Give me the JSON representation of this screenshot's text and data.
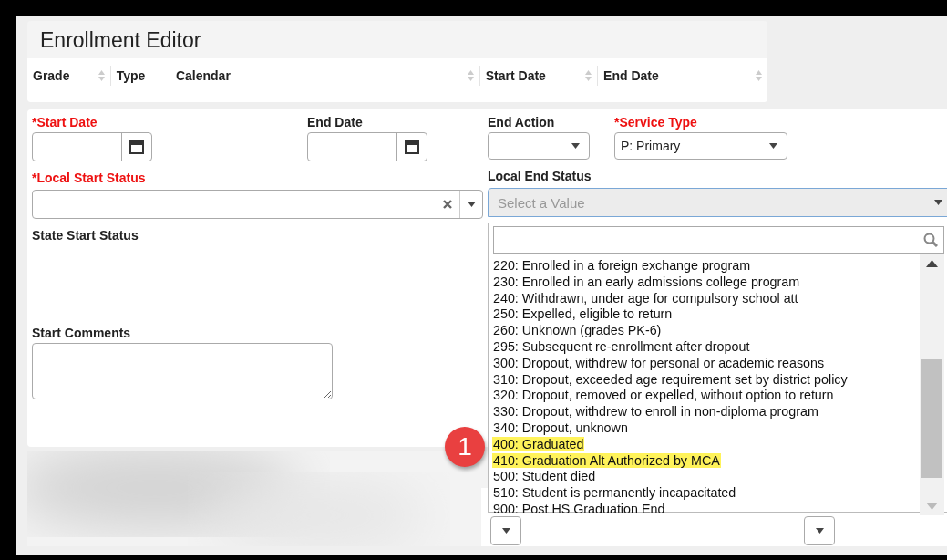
{
  "title": "Enrollment Editor",
  "columns": [
    {
      "label": "Grade",
      "sortable": true
    },
    {
      "label": "Type",
      "sortable": false
    },
    {
      "label": "Calendar",
      "sortable": true
    },
    {
      "label": "Start Date",
      "sortable": true
    },
    {
      "label": "End Date",
      "sortable": true
    }
  ],
  "start_date": {
    "label": "*Start Date",
    "required": true
  },
  "end_date": {
    "label": "End Date",
    "required": false
  },
  "end_action": {
    "label": "End Action",
    "required": false
  },
  "service_type": {
    "label": "*Service Type",
    "required": true,
    "value": "P: Primary"
  },
  "local_start_status": {
    "label": "*Local Start Status",
    "required": true
  },
  "local_end_status": {
    "label": "Local End Status",
    "required": false,
    "placeholder": "Select a Value",
    "expanded": true
  },
  "state_start_status": {
    "label": "State Start Status"
  },
  "start_comments": {
    "label": "Start Comments"
  },
  "options": [
    {
      "label": "220: Enrolled in a foreign exchange program",
      "highlighted": false
    },
    {
      "label": "230: Enrolled in an early admissions college program",
      "highlighted": false
    },
    {
      "label": "240: Withdrawn, under age for compulsory school att",
      "highlighted": false
    },
    {
      "label": "250: Expelled, eligible to return",
      "highlighted": false
    },
    {
      "label": "260: Unknown (grades PK-6)",
      "highlighted": false
    },
    {
      "label": "295: Subsequent re-enrollment after dropout",
      "highlighted": false
    },
    {
      "label": "300: Dropout, withdrew for personal or academic reasons",
      "highlighted": false
    },
    {
      "label": "310: Dropout, exceeded age requirement set by district policy",
      "highlighted": false
    },
    {
      "label": "320: Dropout, removed or expelled, without option to return",
      "highlighted": false
    },
    {
      "label": "330: Dropout, withdrew to enroll in non-diploma program",
      "highlighted": false
    },
    {
      "label": "340: Dropout, unknown",
      "highlighted": false
    },
    {
      "label": "400: Graduated",
      "highlighted": true
    },
    {
      "label": "410: Graduation Alt Authorized by MCA",
      "highlighted": true
    },
    {
      "label": "500: Student died",
      "highlighted": false
    },
    {
      "label": "510: Student is permanently incapacitated",
      "highlighted": false
    },
    {
      "label": "900: Post HS Graduation End",
      "highlighted": false
    }
  ],
  "callout": "1"
}
